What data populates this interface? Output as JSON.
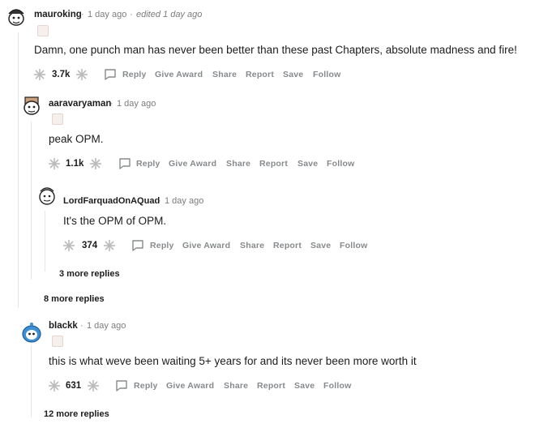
{
  "comments": [
    {
      "username": "mauroking",
      "time": "1 day ago",
      "edited": "edited 1 day ago",
      "body": "Damn, one punch man has never been better than these past Chapters, absolute madness and fire!",
      "score": "3.7k",
      "actions": [
        "Reply",
        "Give Award",
        "Share",
        "Report",
        "Save",
        "Follow"
      ]
    },
    {
      "username": "aaravaryaman",
      "time": "1 day ago",
      "body": "peak OPM.",
      "score": "1.1k",
      "actions": [
        "Reply",
        "Give Award",
        "Share",
        "Report",
        "Save",
        "Follow"
      ]
    },
    {
      "username": "LordFarquadOnAQuad",
      "time": "1 day ago",
      "body": "It's the OPM of OPM.",
      "score": "374",
      "actions": [
        "Reply",
        "Give Award",
        "Share",
        "Report",
        "Save",
        "Follow"
      ]
    },
    {
      "username": "bIackk",
      "time": "1 day ago",
      "body": "this is what weve been waiting 5+ years for and its never been more worth it",
      "score": "631",
      "actions": [
        "Reply",
        "Give Award",
        "Share",
        "Report",
        "Save",
        "Follow"
      ]
    }
  ],
  "more_replies": {
    "level3": "3 more replies",
    "level2": "8 more replies",
    "bottom": "12 more replies"
  },
  "separator": "·"
}
